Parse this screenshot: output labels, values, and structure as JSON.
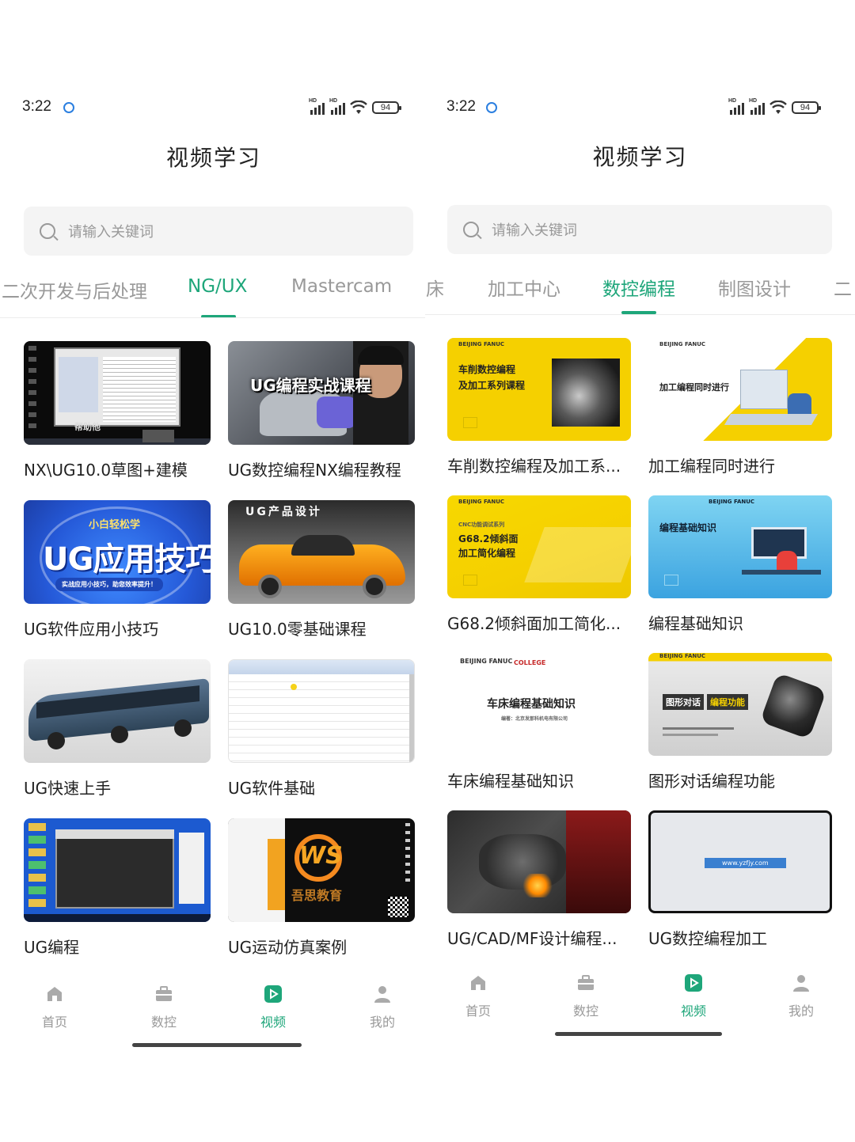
{
  "left": {
    "status": {
      "time": "3:22",
      "battery": "94"
    },
    "title": "视频学习",
    "search": {
      "placeholder": "请输入关键词"
    },
    "tabs": [
      {
        "label": "二次开发与后处理"
      },
      {
        "label": "NG/UX"
      },
      {
        "label": "Mastercam"
      }
    ],
    "active_tab": "NG/UX",
    "cards": [
      {
        "title": "NX\\UG10.0草图+建模",
        "thumb_text": "帮助他"
      },
      {
        "title": "UG数控编程NX编程教程",
        "thumb_text": "UG编程实战课程"
      },
      {
        "title": "UG软件应用小技巧",
        "thumb_text": "UG应用技巧",
        "thumb_sub": "小白轻松学",
        "thumb_banner": "实战应用小技巧，助您效率提升！"
      },
      {
        "title": "UG10.0零基础课程",
        "thumb_text": "UG产品设计"
      },
      {
        "title": "UG快速上手"
      },
      {
        "title": "UG软件基础"
      },
      {
        "title": "UG编程"
      },
      {
        "title": "UG运动仿真案例",
        "thumb_text": "吾思教育"
      }
    ],
    "nav": [
      {
        "label": "首页",
        "icon": "home-icon"
      },
      {
        "label": "数控",
        "icon": "toolbox-icon"
      },
      {
        "label": "视频",
        "icon": "video-icon"
      },
      {
        "label": "我的",
        "icon": "person-icon"
      }
    ]
  },
  "right": {
    "status": {
      "time": "3:22",
      "battery": "94"
    },
    "title": "视频学习",
    "search": {
      "placeholder": "请输入关键词"
    },
    "tabs": [
      {
        "label": "床"
      },
      {
        "label": "加工中心"
      },
      {
        "label": "数控编程"
      },
      {
        "label": "制图设计"
      },
      {
        "label": "二"
      }
    ],
    "active_tab": "数控编程",
    "cards": [
      {
        "title": "车削数控编程及加工系...",
        "thumb_text": "车削数控编程\n及加工系列课程",
        "brand": "BEIJING FANUC"
      },
      {
        "title": "加工编程同时进行",
        "thumb_text": "加工编程同时进行",
        "brand": "BEIJING FANUC"
      },
      {
        "title": "G68.2倾斜面加工简化...",
        "thumb_text": "G68.2倾斜面\n加工简化编程",
        "thumb_sub": "CNC功能调试系列",
        "brand": "BEIJING FANUC"
      },
      {
        "title": "编程基础知识",
        "thumb_text": "编程基础知识",
        "brand": "BEIJING FANUC"
      },
      {
        "title": "车床编程基础知识",
        "thumb_text": "车床编程基础知识",
        "thumb_sub": "编著：北京发那科机电有限公司",
        "brand": "BEIJING FANUC",
        "brand2": "COLLEGE"
      },
      {
        "title": "图形对话编程功能",
        "thumb_text": "图形对话",
        "thumb_text2": "编程功能",
        "brand": "BEIJING FANUC"
      },
      {
        "title": "UG/CAD/MF设计编程..."
      },
      {
        "title": "UG数控编程加工",
        "thumb_text": "www.yzfjy.com"
      }
    ],
    "nav": [
      {
        "label": "首页",
        "icon": "home-icon"
      },
      {
        "label": "数控",
        "icon": "toolbox-icon"
      },
      {
        "label": "视频",
        "icon": "video-icon"
      },
      {
        "label": "我的",
        "icon": "person-icon"
      }
    ]
  },
  "colors": {
    "accent": "#1ea67a",
    "fanuc_yellow": "#f5d000",
    "blue_banner": "#2f6ee0"
  }
}
